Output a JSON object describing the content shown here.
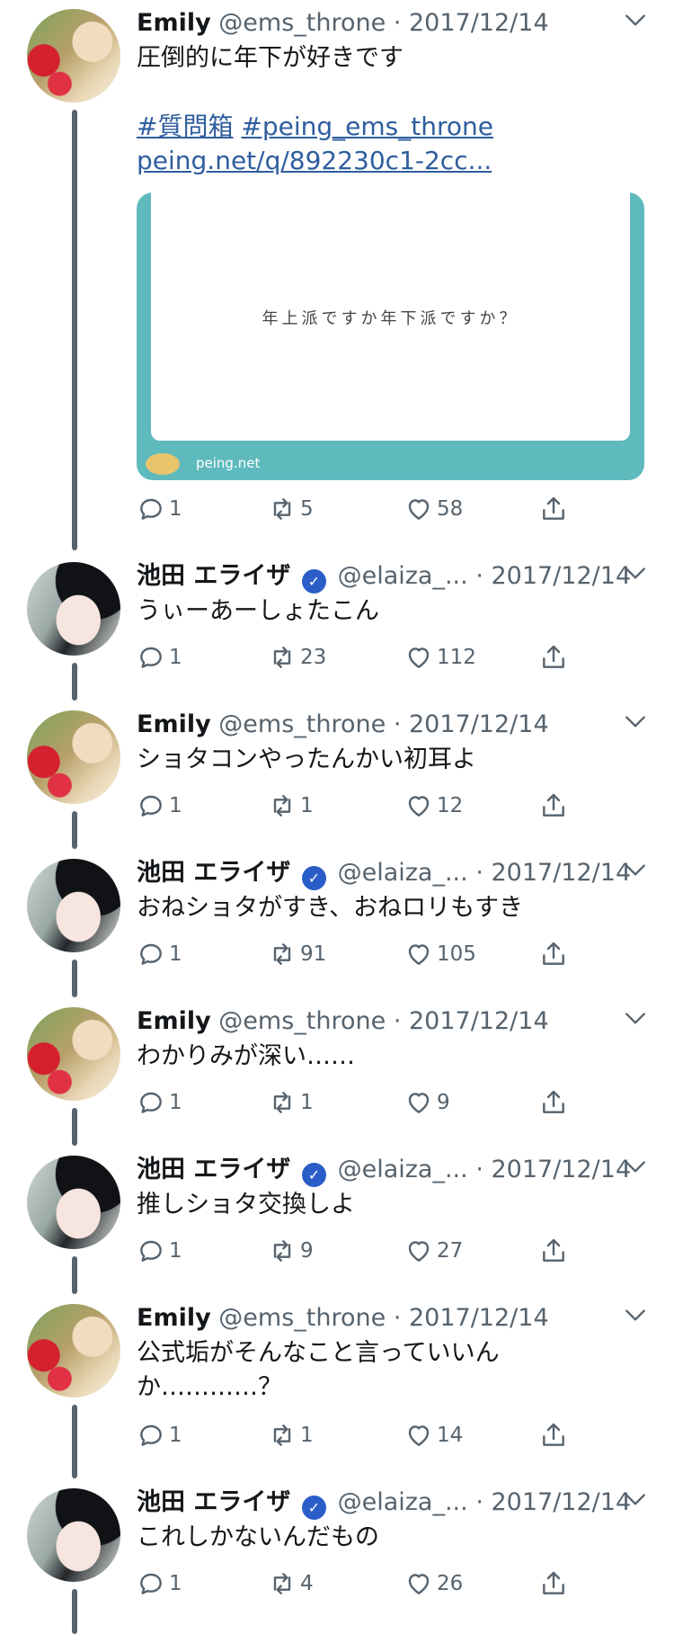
{
  "tweets": [
    {
      "name": "Emily",
      "handle": "@ems_throne",
      "date": "2017/12/14",
      "text": "圧倒的に年下が好きです",
      "hashtag1": "#質問箱",
      "hashtag2": "#peing_ems_throne",
      "link": "peing.net/q/892230c1-2cc...",
      "card": {
        "question": "年上派ですか年下派ですか？",
        "site": "peing.net"
      },
      "replies": "1",
      "retweets": "5",
      "likes": "58"
    },
    {
      "name": "池田 エライザ",
      "handle": "@elaiza_...",
      "date": "2017/12/14",
      "text": "うぃーあーしょたこん",
      "replies": "1",
      "retweets": "23",
      "likes": "112"
    },
    {
      "name": "Emily",
      "handle": "@ems_throne",
      "date": "2017/12/14",
      "text": "ショタコンやったんかい初耳よ",
      "replies": "1",
      "retweets": "1",
      "likes": "12"
    },
    {
      "name": "池田 エライザ",
      "handle": "@elaiza_...",
      "date": "2017/12/14",
      "text": "おねショタがすき、おねロリもすき",
      "replies": "1",
      "retweets": "91",
      "likes": "105"
    },
    {
      "name": "Emily",
      "handle": "@ems_throne",
      "date": "2017/12/14",
      "text": "わかりみが深い……",
      "replies": "1",
      "retweets": "1",
      "likes": "9"
    },
    {
      "name": "池田 エライザ",
      "handle": "@elaiza_...",
      "date": "2017/12/14",
      "text": "推しショタ交換しよ",
      "replies": "1",
      "retweets": "9",
      "likes": "27"
    },
    {
      "name": "Emily",
      "handle": "@ems_throne",
      "date": "2017/12/14",
      "text": "公式垢がそんなこと言っていいんか…………？",
      "replies": "1",
      "retweets": "1",
      "likes": "14"
    },
    {
      "name": "池田 エライザ",
      "handle": "@elaiza_...",
      "date": "2017/12/14",
      "text": "これしかないんだもの",
      "replies": "1",
      "retweets": "4",
      "likes": "26"
    }
  ],
  "icons": {
    "reply": "reply-icon",
    "retweet": "retweet-icon",
    "like": "heart-icon",
    "share": "share-icon",
    "menu": "chevron-down-icon",
    "verified": "verified-badge-icon"
  },
  "colors": {
    "text": "#14171a",
    "secondary": "#56636e",
    "link": "#2f5d9e",
    "verified": "#2a5dc8",
    "card_bg": "#5fbabd"
  }
}
